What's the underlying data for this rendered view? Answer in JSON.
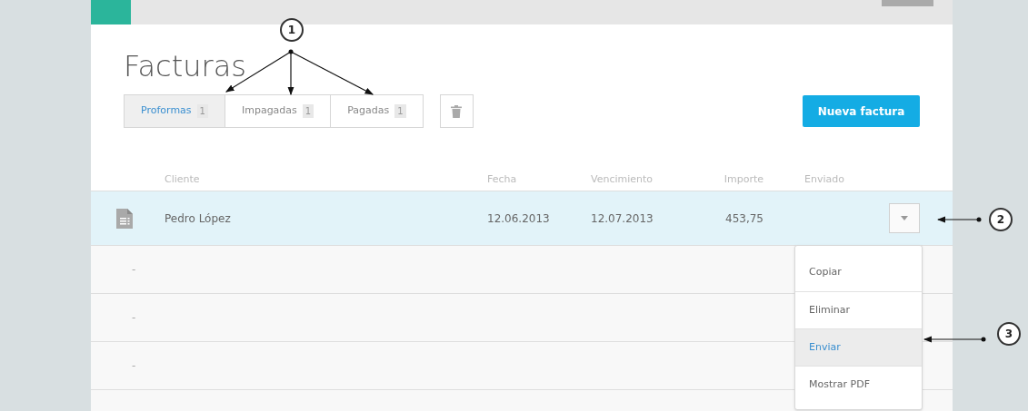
{
  "title": "Facturas",
  "tabs": [
    {
      "label": "Proformas",
      "count": "1",
      "selected": true
    },
    {
      "label": "Impagadas",
      "count": "1",
      "selected": false
    },
    {
      "label": "Pagadas",
      "count": "1",
      "selected": false
    }
  ],
  "new_button": "Nueva factura",
  "columns": [
    "Cliente",
    "Fecha",
    "Vencimiento",
    "Importe",
    "Enviado"
  ],
  "rows": [
    {
      "kind": "invoice",
      "cliente": "Pedro López",
      "fecha": "12.06.2013",
      "vencimiento": "12.07.2013",
      "importe": "453,75",
      "selected": true
    },
    {
      "kind": "empty",
      "cliente": "-",
      "selected": false
    },
    {
      "kind": "empty",
      "cliente": "-",
      "selected": false
    },
    {
      "kind": "empty",
      "cliente": "-",
      "selected": false
    },
    {
      "kind": "blank",
      "selected": false
    }
  ],
  "menu": [
    {
      "label": "Copiar",
      "selected": false
    },
    {
      "label": "Eliminar",
      "selected": false
    },
    {
      "label": "Enviar",
      "selected": true
    },
    {
      "label": "Mostrar PDF",
      "selected": false
    }
  ],
  "annotations": [
    "1",
    "2",
    "3"
  ]
}
